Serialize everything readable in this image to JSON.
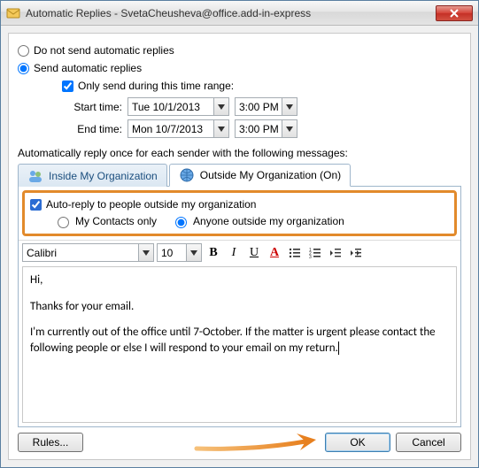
{
  "title": "Automatic Replies - SvetaCheusheva@office.add-in-express",
  "radios": {
    "dont_send": "Do not send automatic replies",
    "send": "Send automatic replies"
  },
  "time_range": {
    "checkbox_label": "Only send during this time range:",
    "start_label": "Start time:",
    "start_date": "Tue 10/1/2013",
    "start_time": "3:00 PM",
    "end_label": "End time:",
    "end_date": "Mon 10/7/2013",
    "end_time": "3:00 PM"
  },
  "section_label": "Automatically reply once for each sender with the following messages:",
  "tabs": {
    "inside": "Inside My Organization",
    "outside": "Outside My Organization (On)"
  },
  "outside_opts": {
    "checkbox": "Auto-reply to people outside my organization",
    "contacts_only": "My Contacts only",
    "anyone": "Anyone outside my organization"
  },
  "format": {
    "font": "Calibri",
    "size": "10"
  },
  "message": {
    "p1": "Hi,",
    "p2": "Thanks for your email.",
    "p3a": "I'm currently out of the office until 7-October. If the matter is urgent please contact the following people or else I will respond to your email on my return.",
    "p3b": ""
  },
  "buttons": {
    "rules": "Rules...",
    "ok": "OK",
    "cancel": "Cancel"
  }
}
